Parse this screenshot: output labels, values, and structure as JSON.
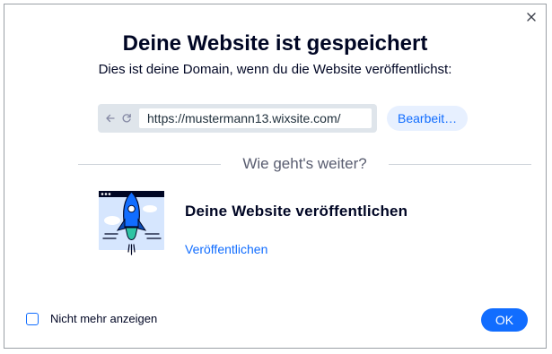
{
  "dialog": {
    "title": "Deine Website ist gespeichert",
    "subtitle": "Dies ist deine Domain, wenn du die Website veröffentlichst:",
    "close_icon": "close-icon"
  },
  "domain": {
    "url": "https://mustermann13.wixsite.com/",
    "edit_label": "Bearbeit…",
    "back_icon": "arrow-left-icon",
    "reload_icon": "reload-icon"
  },
  "next_steps": {
    "heading": "Wie geht's weiter?",
    "publish_title": "Deine Website veröffentlichen",
    "publish_link": "Veröffentlichen",
    "illustration_icon": "rocket-launch-icon"
  },
  "footer": {
    "checkbox_label": "Nicht mehr anzeigen",
    "checkbox_checked": false,
    "ok_label": "OK"
  },
  "colors": {
    "accent": "#116dff",
    "text_dark": "#000624",
    "browser_bar": "#dfe5eb",
    "rocket_green": "#2ec4a4"
  }
}
